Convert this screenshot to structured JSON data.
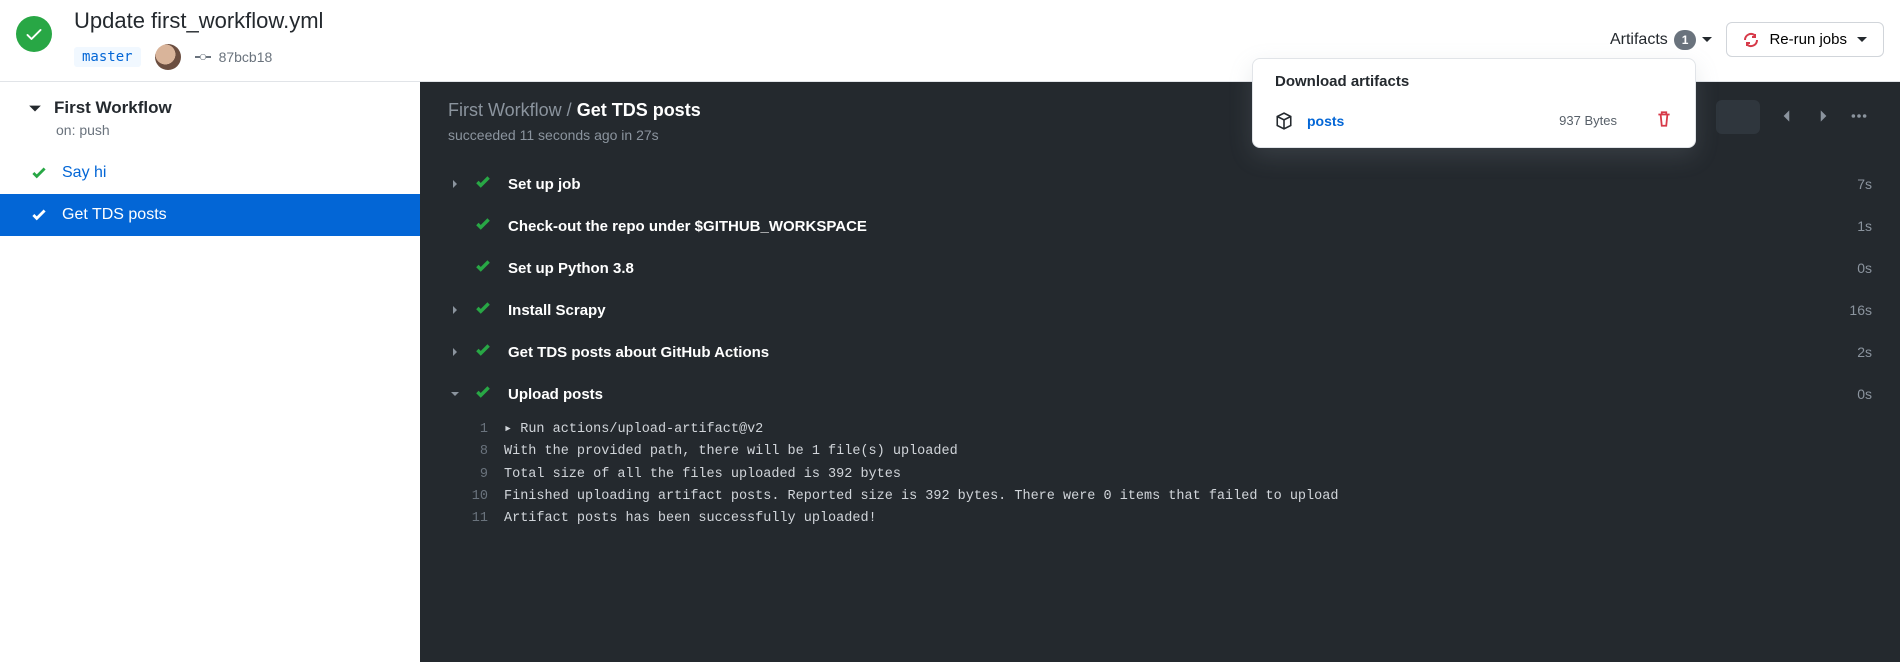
{
  "header": {
    "commit_title": "Update first_workflow.yml",
    "branch": "master",
    "commit_hash": "87bcb18",
    "artifacts_label": "Artifacts",
    "artifacts_count": "1",
    "rerun_label": "Re-run jobs"
  },
  "artifacts_popover": {
    "title": "Download artifacts",
    "items": [
      {
        "name": "posts",
        "size": "937 Bytes"
      }
    ]
  },
  "sidebar": {
    "workflow_title": "First Workflow",
    "workflow_sub": "on: push",
    "jobs": [
      {
        "label": "Say hi",
        "selected": false
      },
      {
        "label": "Get TDS posts",
        "selected": true
      }
    ]
  },
  "main": {
    "crumb_workflow": "First Workflow",
    "crumb_job": "Get TDS posts",
    "status_line": "succeeded 11 seconds ago in 27s",
    "steps": [
      {
        "label": "Set up job",
        "duration": "7s",
        "expandable": true,
        "expanded": false
      },
      {
        "label": "Check-out the repo under $GITHUB_WORKSPACE",
        "duration": "1s",
        "expandable": false
      },
      {
        "label": "Set up Python 3.8",
        "duration": "0s",
        "expandable": false
      },
      {
        "label": "Install Scrapy",
        "duration": "16s",
        "expandable": true,
        "expanded": false
      },
      {
        "label": "Get TDS posts about GitHub Actions",
        "duration": "2s",
        "expandable": true,
        "expanded": false
      },
      {
        "label": "Upload posts",
        "duration": "0s",
        "expandable": true,
        "expanded": true
      }
    ],
    "log": [
      {
        "n": "1",
        "text": "Run actions/upload-artifact@v2",
        "caret": true
      },
      {
        "n": "8",
        "text": "With the provided path, there will be 1 file(s) uploaded"
      },
      {
        "n": "9",
        "text": "Total size of all the files uploaded is 392 bytes"
      },
      {
        "n": "10",
        "text": "Finished uploading artifact posts. Reported size is 392 bytes. There were 0 items that failed to upload"
      },
      {
        "n": "11",
        "text": "Artifact posts has been successfully uploaded!"
      }
    ]
  }
}
